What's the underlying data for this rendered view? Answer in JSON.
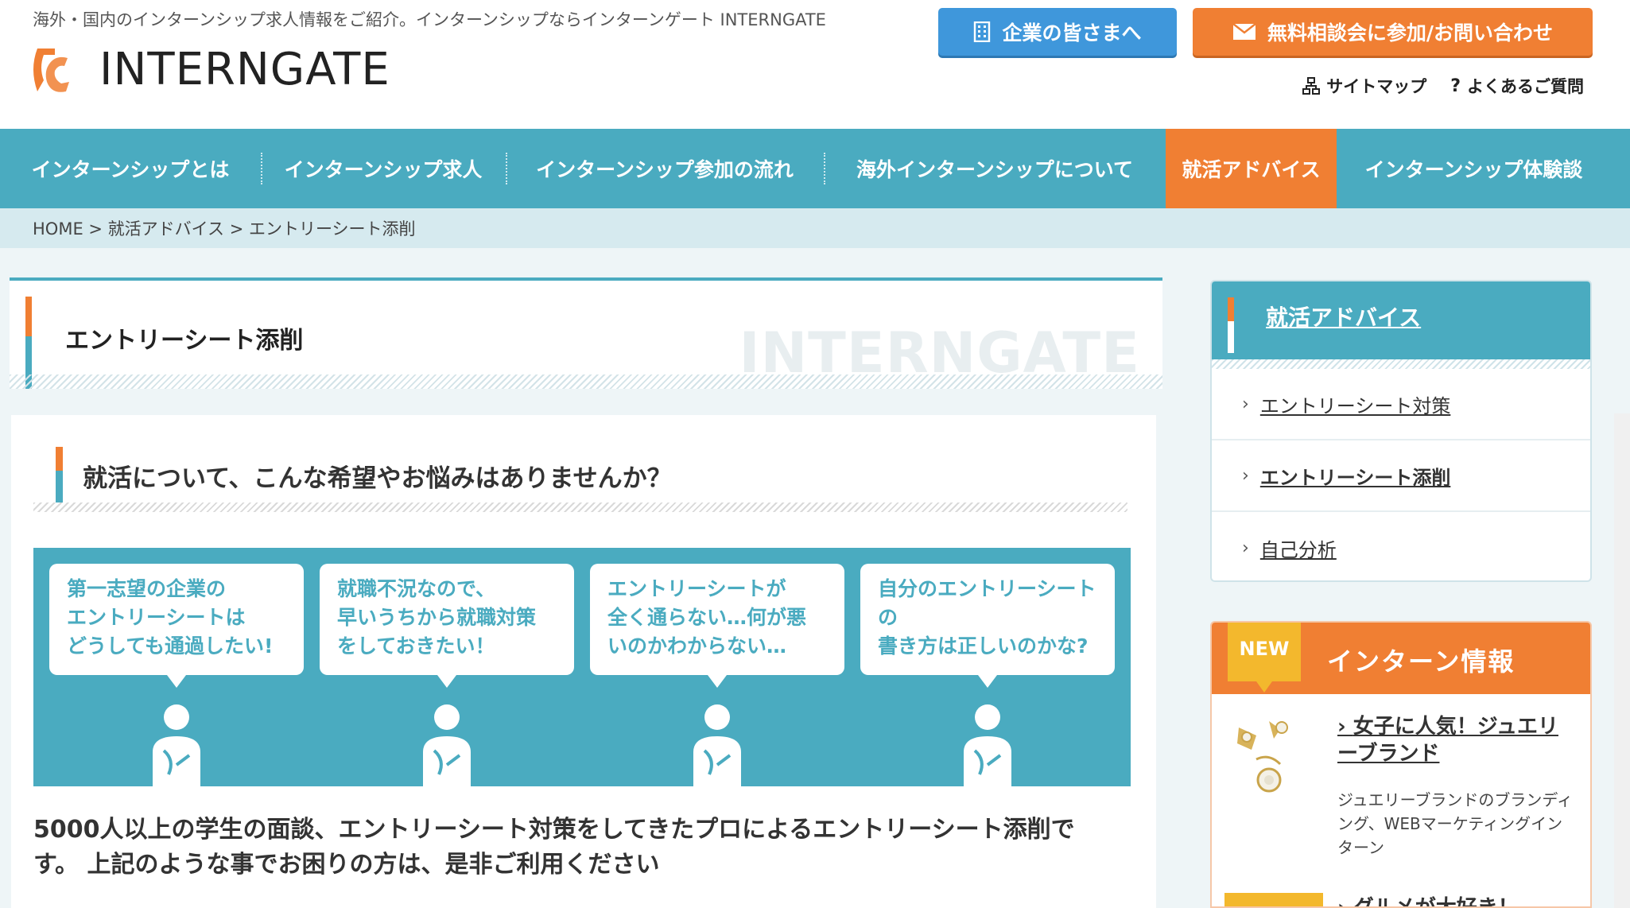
{
  "header": {
    "tagline": "海外・国内のインターンシップ求人情報をご紹介。インターンシップならインターンゲート INTERNGATE",
    "logo_text": "INTERNGATE",
    "corp_button": "企業の皆さまへ",
    "contact_button": "無料相談会に参加/お問い合わせ",
    "sitemap": "サイトマップ",
    "faq": "よくあるご質問"
  },
  "nav": {
    "items": [
      {
        "label": "インターンシップとは"
      },
      {
        "label": "インターンシップ求人"
      },
      {
        "label": "インターンシップ参加の流れ"
      },
      {
        "label": "海外インターンシップについて"
      },
      {
        "label": "就活アドバイス"
      },
      {
        "label": "インターンシップ体験談"
      }
    ]
  },
  "breadcrumb": "HOME > 就活アドバイス > エントリーシート添削",
  "page": {
    "title": "エントリーシート添削",
    "watermark": "INTERNGATE",
    "section_title": "就活について、こんな希望やお悩みはありませんか？",
    "bubbles": [
      [
        "第一志望の企業の",
        "エントリーシートは",
        "どうしても通過したい!"
      ],
      [
        "就職不況なので、",
        "早いうちから就職対策",
        "をしておきたい！"
      ],
      [
        "エントリーシートが",
        "全く通らない…何が悪",
        "いのかわからない…"
      ],
      [
        "自分のエントリーシートの",
        "書き方は正しいのかな?"
      ]
    ],
    "lead_line1": "5000人以上の学生の面談、エントリーシート対策をしてきたプロによるエントリーシート添削で",
    "lead_line2": "す。 上記のような事でお困りの方は、是非ご利用ください"
  },
  "sidebar": {
    "heading": "就活アドバイス",
    "items": [
      {
        "label": "エントリーシート対策"
      },
      {
        "label": "エントリーシート添削"
      },
      {
        "label": "自己分析"
      }
    ],
    "intern": {
      "badge": "NEW",
      "title": "インターン情報",
      "news_title": "女子に人気！ジュエリーブランド",
      "news_desc": "ジュエリーブランドのブランディング、WEBマーケティングインターン",
      "next_title": "グルメが大好き！"
    }
  },
  "colors": {
    "teal": "#4aabc0",
    "orange": "#f07f33",
    "blue": "#3f97db",
    "yellow": "#f3b82d"
  }
}
